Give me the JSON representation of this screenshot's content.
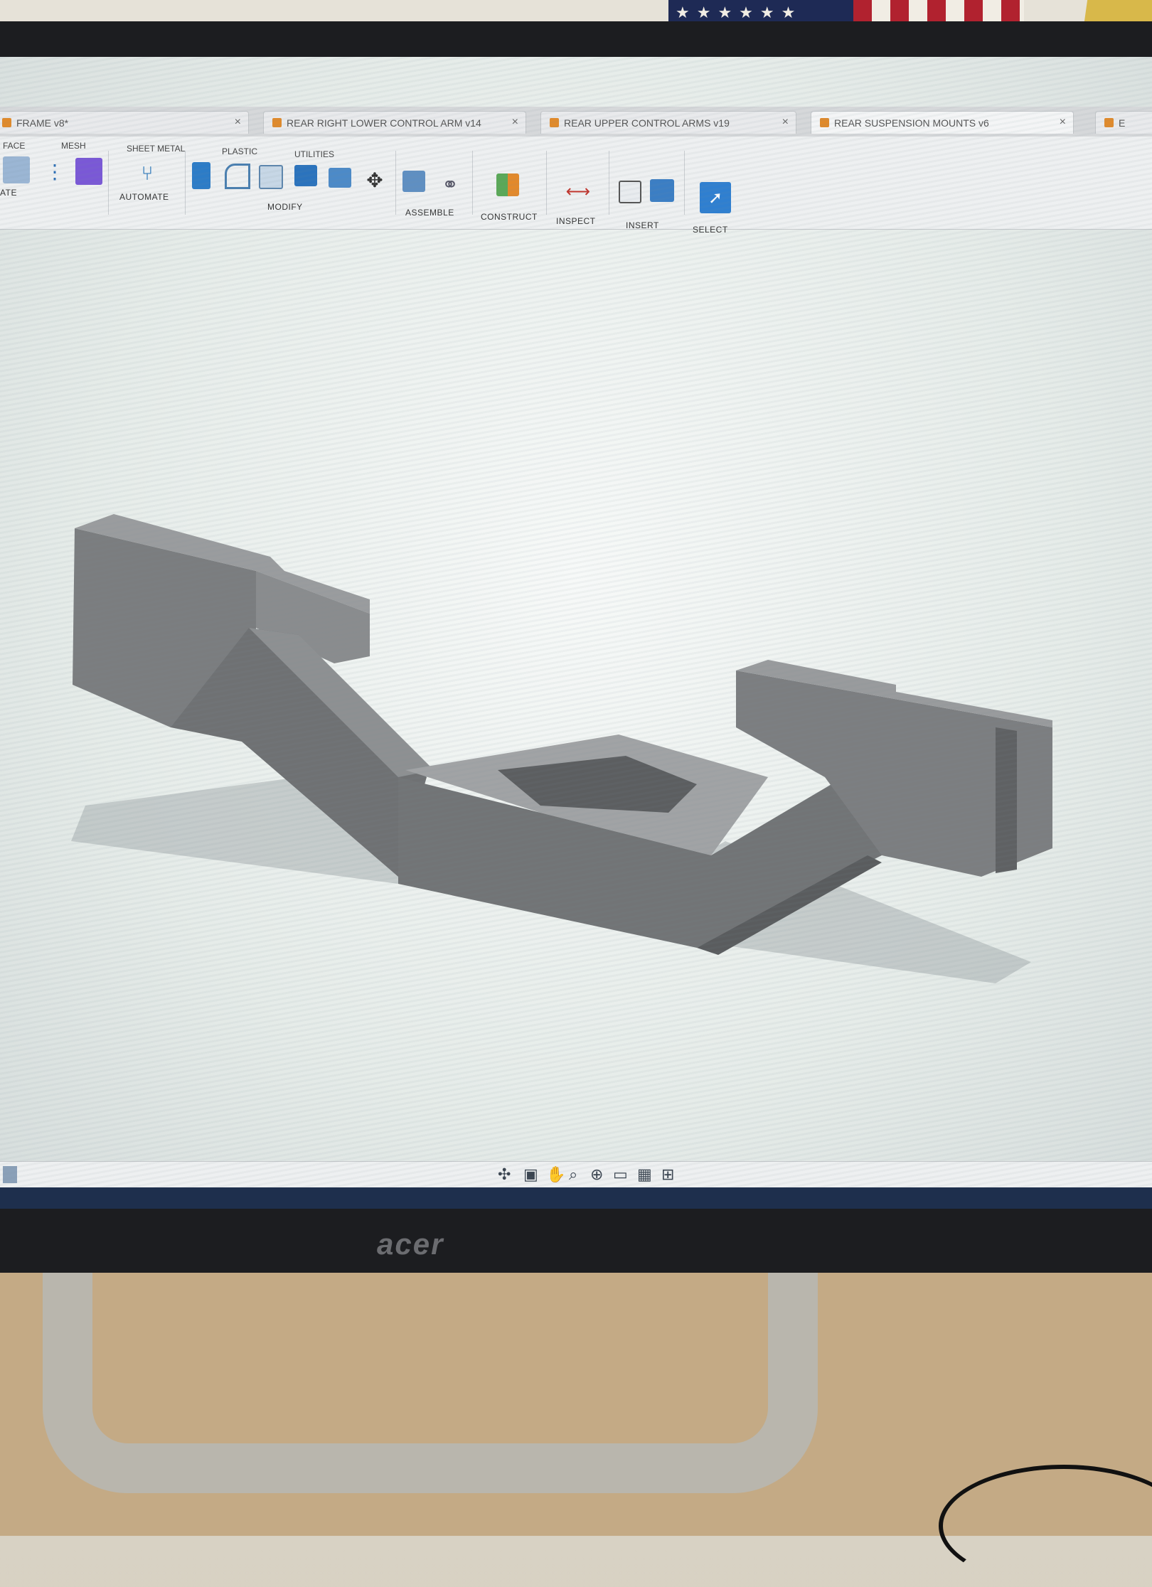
{
  "app": {
    "tabs": [
      {
        "label": "FRAME v8*",
        "active": false
      },
      {
        "label": "REAR RIGHT LOWER CONTROL ARM v14",
        "active": false
      },
      {
        "label": "REAR UPPER CONTROL ARMS v19",
        "active": false
      },
      {
        "label": "REAR SUSPENSION MOUNTS v6",
        "active": true
      },
      {
        "label": "E",
        "active": false
      }
    ],
    "tab_close_glyph": "×"
  },
  "toolbar": {
    "workspace_tabs": [
      "FACE",
      "MESH",
      "SHEET METAL",
      "PLASTIC",
      "UTILITIES"
    ],
    "partial_create": "ATE",
    "groups": [
      {
        "label": "AUTOMATE",
        "icon": "automate-icon"
      },
      {
        "label": "MODIFY",
        "icon": "modify-icon"
      },
      {
        "label": "ASSEMBLE",
        "icon": "assemble-icon"
      },
      {
        "label": "CONSTRUCT",
        "icon": "construct-icon"
      },
      {
        "label": "INSPECT",
        "icon": "inspect-icon"
      },
      {
        "label": "INSERT",
        "icon": "insert-icon"
      },
      {
        "label": "SELECT",
        "icon": "select-icon"
      }
    ],
    "dropdown_glyph": "▾"
  },
  "viewport": {
    "model_color": "#7a7c7e",
    "shadow_color": "#9ea4a6"
  },
  "nav_bar": {
    "items": [
      "orbit-icon",
      "look-at-icon",
      "pan-icon",
      "zoom-icon",
      "fit-icon",
      "display-settings-icon",
      "grid-icon",
      "viewports-icon"
    ]
  },
  "monitor": {
    "brand": "acer"
  }
}
